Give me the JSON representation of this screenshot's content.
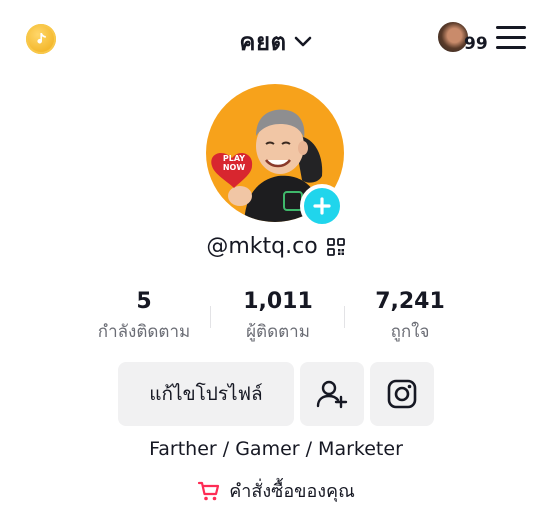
{
  "header": {
    "title": "คยต",
    "friends_badge": "99",
    "icons": {
      "coin": "tiktok-coin-icon",
      "dropdown": "chevron-down-icon",
      "menu": "hamburger-menu-icon"
    }
  },
  "profile": {
    "username": "@mktq.co",
    "avatar_badge_text": "PLAY NOW",
    "bio": "Farther / Gamer / Marketer"
  },
  "stats": [
    {
      "value": "5",
      "label": "กำลังติดตาม"
    },
    {
      "value": "1,011",
      "label": "ผู้ติดตาม"
    },
    {
      "value": "7,241",
      "label": "ถูกใจ"
    }
  ],
  "actions": {
    "edit_profile_label": "แก้ไขโปรไฟล์"
  },
  "orders": {
    "label": "คำสั่งซื้อของคุณ"
  },
  "colors": {
    "accent_cyan": "#20d5ec",
    "cart_red": "#fe2c55",
    "avatar_bg": "#f7a21b",
    "button_bg": "#f1f1f2",
    "secondary_text": "#6b6d75"
  }
}
